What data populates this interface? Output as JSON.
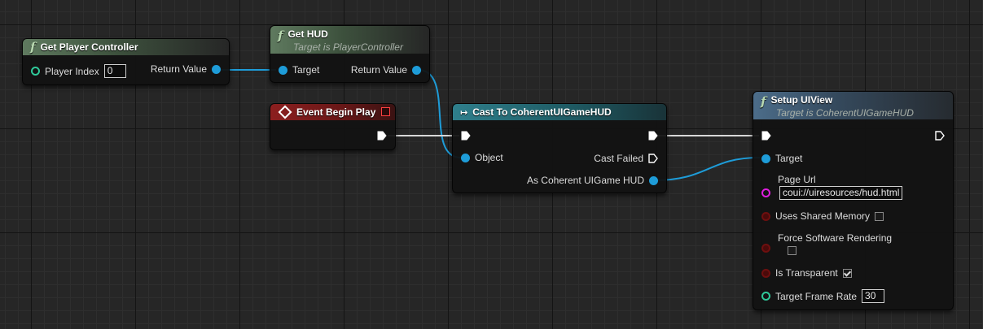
{
  "nodes": {
    "get_player_controller": {
      "title": "Get Player Controller",
      "player_index_label": "Player Index",
      "player_index_value": "0",
      "return_label": "Return Value"
    },
    "get_hud": {
      "title": "Get HUD",
      "subtitle": "Target is PlayerController",
      "target_label": "Target",
      "return_label": "Return Value"
    },
    "event_begin_play": {
      "title": "Event Begin Play"
    },
    "cast": {
      "title": "Cast To CoherentUIGameHUD",
      "object_label": "Object",
      "cast_failed_label": "Cast Failed",
      "as_label": "As Coherent UIGame HUD"
    },
    "setup_uiview": {
      "title": "Setup UIView",
      "subtitle": "Target is CoherentUIGameHUD",
      "target_label": "Target",
      "page_url_label": "Page Url",
      "page_url_value": "coui://uiresources/hud.html",
      "shared_memory_label": "Uses Shared Memory",
      "shared_memory_checked": false,
      "force_software_label": "Force Software Rendering",
      "force_software_checked": false,
      "transparent_label": "Is Transparent",
      "transparent_checked": true,
      "frame_rate_label": "Target Frame Rate",
      "frame_rate_value": "30"
    }
  },
  "colors": {
    "object_pin": "#1e9cd8",
    "int_pin": "#2fc99a",
    "string_pin": "#e01ee0",
    "bool_pin": "#6e0f0f",
    "exec_wire": "#ffffff"
  },
  "icons": {
    "function": "function-icon",
    "event": "event-diamond-icon",
    "cast": "cast-arrow-icon"
  }
}
